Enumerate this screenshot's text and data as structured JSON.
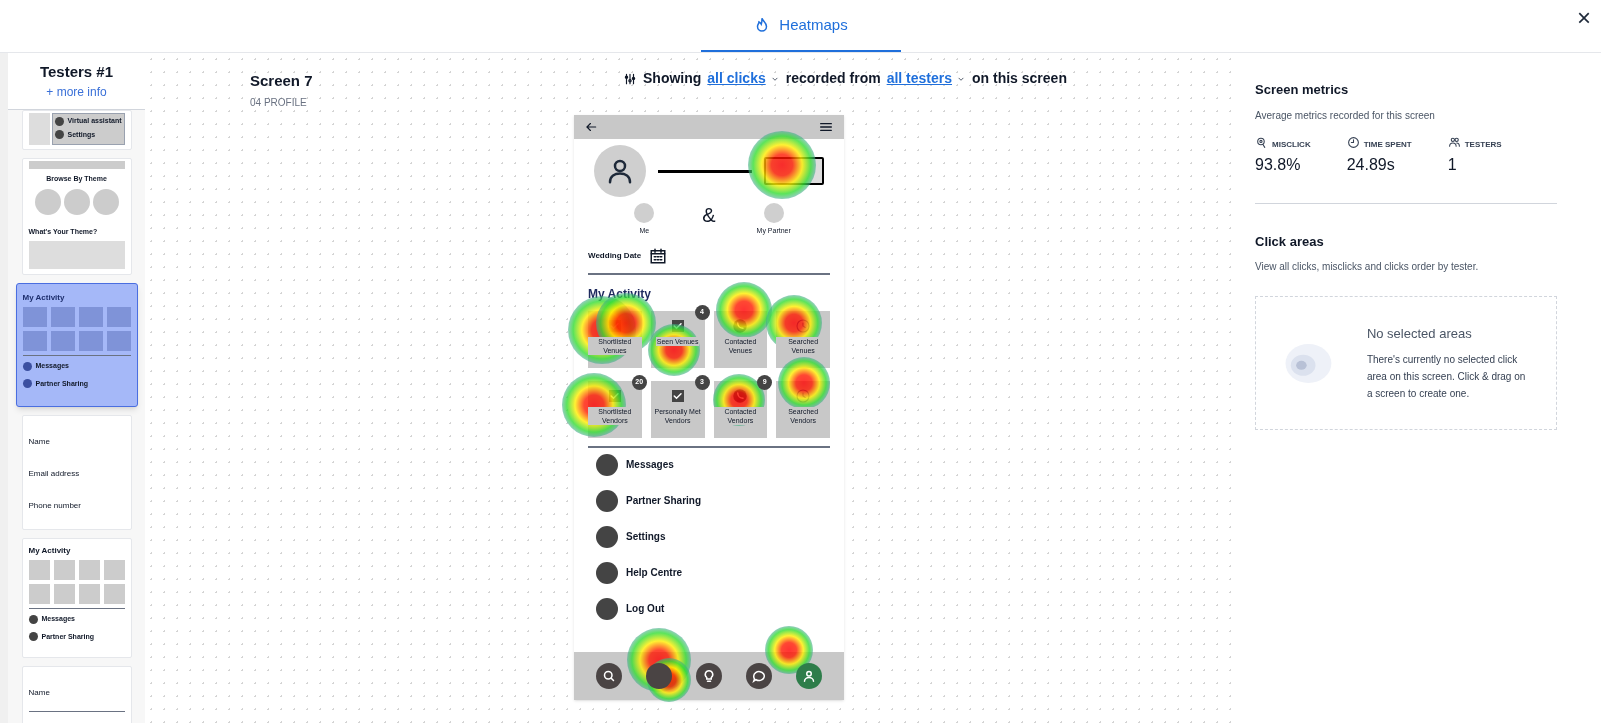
{
  "top_bar": {
    "tab": {
      "label": "Heatmaps",
      "selected": true
    },
    "close": "×"
  },
  "sidebar": {
    "title": "Testers #1",
    "link": "+ more info",
    "thumbnails": [
      {
        "kind": "menu",
        "selected": false,
        "texts": [
          "Virtual assistant",
          "Settings"
        ]
      },
      {
        "kind": "browse",
        "selected": false,
        "texts": [
          "Browse By Theme",
          "What's Your Theme?"
        ]
      },
      {
        "kind": "activity",
        "selected": true,
        "texts": [
          "My Activity",
          "Messages",
          "Partner Sharing"
        ]
      },
      {
        "kind": "form",
        "selected": false,
        "texts": [
          "Name",
          "Email address",
          "Phone number"
        ]
      },
      {
        "kind": "activity",
        "selected": false,
        "texts": [
          "My Activity",
          "Messages",
          "Partner Sharing"
        ]
      },
      {
        "kind": "form",
        "selected": false,
        "texts": [
          "Name"
        ]
      }
    ]
  },
  "screen": {
    "title": "Screen 7",
    "subtitle": "04 PROFILE"
  },
  "filter": {
    "showing": "Showing",
    "clicks": "all clicks",
    "recorded_from": "recorded from",
    "testers": "all testers",
    "suffix": "on this screen"
  },
  "phone": {
    "me": "Me",
    "amp": "&",
    "partner": "My Partner",
    "wedding_date": "Wedding Date",
    "activity_title": "My Activity",
    "tiles": [
      {
        "kind": "check",
        "label": "Shortlisted Venues"
      },
      {
        "kind": "check",
        "label": "Seen Venues",
        "badge": "4"
      },
      {
        "kind": "phone",
        "label": "Contacted Venues"
      },
      {
        "kind": "clock",
        "label": "Searched Venues"
      },
      {
        "kind": "check",
        "label": "Shortlisted Vendors",
        "badge": "20"
      },
      {
        "kind": "check",
        "label": "Personally Met Vendors",
        "badge": "3"
      },
      {
        "kind": "phone",
        "label": "Contacted Vendors",
        "badge": "9"
      },
      {
        "kind": "clock",
        "label": "Searched Vendors"
      }
    ],
    "menu": [
      "Messages",
      "Partner Sharing",
      "Settings",
      "Help Centre",
      "Log Out"
    ],
    "nav": [
      {
        "kind": "search"
      },
      {
        "kind": "home"
      },
      {
        "kind": "bulb"
      },
      {
        "kind": "chat"
      },
      {
        "kind": "profile",
        "selected": true
      }
    ]
  },
  "metrics": {
    "title": "Screen metrics",
    "subtitle": "Average metrics recorded for this screen",
    "items": [
      {
        "kind": "misclick",
        "label": "MISCLICK",
        "value": "93.8%"
      },
      {
        "kind": "time",
        "label": "TIME SPENT",
        "value": "24.89s"
      },
      {
        "kind": "testers",
        "label": "TESTERS",
        "value": "1"
      }
    ]
  },
  "click_areas": {
    "title": "Click areas",
    "subtitle": "View all clicks, misclicks and clicks order by tester.",
    "empty_title": "No selected areas",
    "empty_text": "There's currently no selected click area on this screen. Click & drag on a screen to create one."
  }
}
